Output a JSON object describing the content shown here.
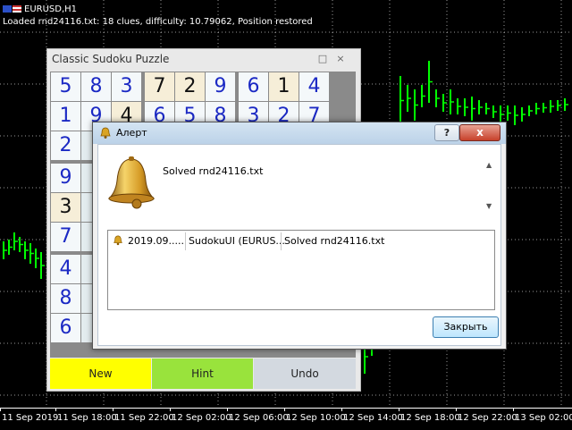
{
  "chart": {
    "symbol": "EURUSD,H1",
    "status": "Loaded rnd24116.txt: 18 clues, difficulty: 10.79062, Position restored",
    "time_labels": [
      "11 Sep 2019",
      "11 Sep 18:00",
      "11 Sep 22:00",
      "12 Sep 02:00",
      "12 Sep 06:00",
      "12 Sep 10:00",
      "12 Sep 14:00",
      "12 Sep 18:00",
      "12 Sep 22:00",
      "13 Sep 02:00"
    ],
    "colors": {
      "background": "#000000",
      "candles": "#00ff00",
      "grid": "#ffffff",
      "text": "#ffffff"
    }
  },
  "sudoku": {
    "title": "Classic Sudoku Puzzle",
    "controls": {
      "minimize": "□",
      "close": "×"
    },
    "rows": [
      [
        {
          "v": "5"
        },
        {
          "v": "8"
        },
        {
          "v": "3"
        },
        {
          "v": "7",
          "g": true
        },
        {
          "v": "2",
          "g": true
        },
        {
          "v": "9"
        },
        {
          "v": "6"
        },
        {
          "v": "1",
          "g": true
        },
        {
          "v": "4"
        }
      ],
      [
        {
          "v": "1"
        },
        {
          "v": "9"
        },
        {
          "v": "4",
          "g": true
        },
        {
          "v": "6"
        },
        {
          "v": "5"
        },
        {
          "v": "8"
        },
        {
          "v": "3"
        },
        {
          "v": "2"
        },
        {
          "v": "7"
        }
      ],
      [
        {
          "v": "2"
        },
        {
          "v": ""
        },
        {
          "v": ""
        },
        {
          "v": ""
        },
        {
          "v": ""
        },
        {
          "v": ""
        },
        {
          "v": ""
        },
        {
          "v": ""
        },
        {
          "v": ""
        }
      ],
      [
        {
          "v": "9"
        },
        {
          "v": ""
        },
        {
          "v": ""
        },
        {
          "v": ""
        },
        {
          "v": ""
        },
        {
          "v": ""
        },
        {
          "v": ""
        },
        {
          "v": ""
        },
        {
          "v": ""
        }
      ],
      [
        {
          "v": "3",
          "g": true
        },
        {
          "v": ""
        },
        {
          "v": ""
        },
        {
          "v": ""
        },
        {
          "v": ""
        },
        {
          "v": ""
        },
        {
          "v": ""
        },
        {
          "v": ""
        },
        {
          "v": ""
        }
      ],
      [
        {
          "v": "7"
        },
        {
          "v": ""
        },
        {
          "v": ""
        },
        {
          "v": ""
        },
        {
          "v": ""
        },
        {
          "v": ""
        },
        {
          "v": ""
        },
        {
          "v": ""
        },
        {
          "v": ""
        }
      ],
      [
        {
          "v": "4"
        },
        {
          "v": ""
        },
        {
          "v": ""
        },
        {
          "v": ""
        },
        {
          "v": ""
        },
        {
          "v": ""
        },
        {
          "v": ""
        },
        {
          "v": ""
        },
        {
          "v": ""
        }
      ],
      [
        {
          "v": "8"
        },
        {
          "v": ""
        },
        {
          "v": ""
        },
        {
          "v": ""
        },
        {
          "v": ""
        },
        {
          "v": ""
        },
        {
          "v": ""
        },
        {
          "v": ""
        },
        {
          "v": ""
        }
      ],
      [
        {
          "v": "6"
        },
        {
          "v": ""
        },
        {
          "v": ""
        },
        {
          "v": ""
        },
        {
          "v": ""
        },
        {
          "v": ""
        },
        {
          "v": ""
        },
        {
          "v": ""
        },
        {
          "v": ""
        }
      ]
    ],
    "buttons": {
      "new": {
        "label": "New",
        "color": "#ffff00"
      },
      "hint": {
        "label": "Hint",
        "color": "#99e33c"
      },
      "undo": {
        "label": "Undo",
        "color": "#d3d9e0"
      }
    }
  },
  "alert": {
    "title": "Алерт",
    "help_label": "?",
    "close_x_label": "x",
    "message": "Solved rnd24116.txt",
    "log": [
      {
        "time": "2019.09.....",
        "source": "SudokuUI (EURUS...",
        "message": "Solved rnd24116.txt"
      }
    ],
    "close_button": "Закрыть"
  }
}
